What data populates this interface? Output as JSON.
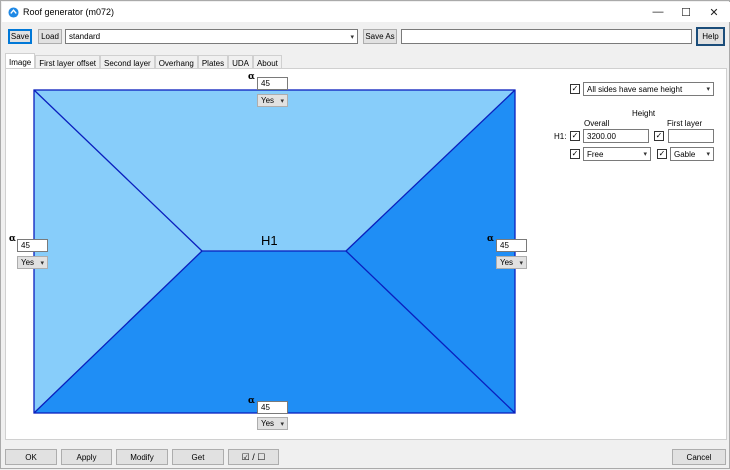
{
  "window": {
    "title": "Roof generator (m072)",
    "controls": {
      "minimize": "—",
      "maximize": "☐",
      "close": "✕"
    }
  },
  "toolbar": {
    "save": "Save",
    "load": "Load",
    "preset": "standard",
    "save_as": "Save As",
    "save_as_name": "",
    "help": "Help"
  },
  "tabs": [
    "Image",
    "First layer offset",
    "Second layer",
    "Overhang",
    "Plates",
    "UDA",
    "About"
  ],
  "roof": {
    "label": "H1",
    "colors": {
      "light_face": "#87cdfa",
      "dark_face": "#1f8ef5",
      "edge": "#0a1fbe"
    },
    "sides": {
      "top": {
        "symbol": "α",
        "angle": "45",
        "option": "Yes"
      },
      "left": {
        "symbol": "α",
        "angle": "45",
        "option": "Yes"
      },
      "right": {
        "symbol": "α",
        "angle": "45",
        "option": "Yes"
      },
      "bottom": {
        "symbol": "α",
        "angle": "45",
        "option": "Yes"
      }
    }
  },
  "settings": {
    "same_height_checked": true,
    "same_height": "All sides have same height",
    "height_header": "Height",
    "overall_header": "Overall",
    "first_layer_header": "First layer",
    "row_label": "H1:",
    "overall_checked": true,
    "overall_value": "3200.00",
    "first_layer_checked": true,
    "first_layer_value": "",
    "type_checked": true,
    "type_value": "Free",
    "shape_checked": true,
    "shape_value": "Gable"
  },
  "bottom_bar": {
    "ok": "OK",
    "apply": "Apply",
    "modify": "Modify",
    "get": "Get",
    "toggle": "☑ / ☐",
    "cancel": "Cancel"
  }
}
